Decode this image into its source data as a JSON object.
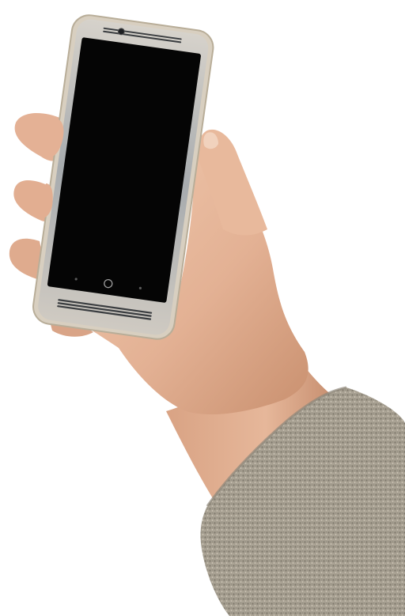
{
  "scene": {
    "background_color": "#ffffff",
    "subject": "hand-holding-smartphone",
    "colors": {
      "skin": "#e6b79a",
      "skin_shadow": "#c58f72",
      "sleeve": "#a59e90",
      "sleeve_dark": "#7f796d",
      "phone_frame": "#c9c4bb",
      "phone_body": "#9aa0a6",
      "screen": "#050505"
    },
    "phone": {
      "screen_state": "off",
      "nav_buttons": [
        "back-dot",
        "home-circle",
        "recent-dot"
      ]
    }
  }
}
